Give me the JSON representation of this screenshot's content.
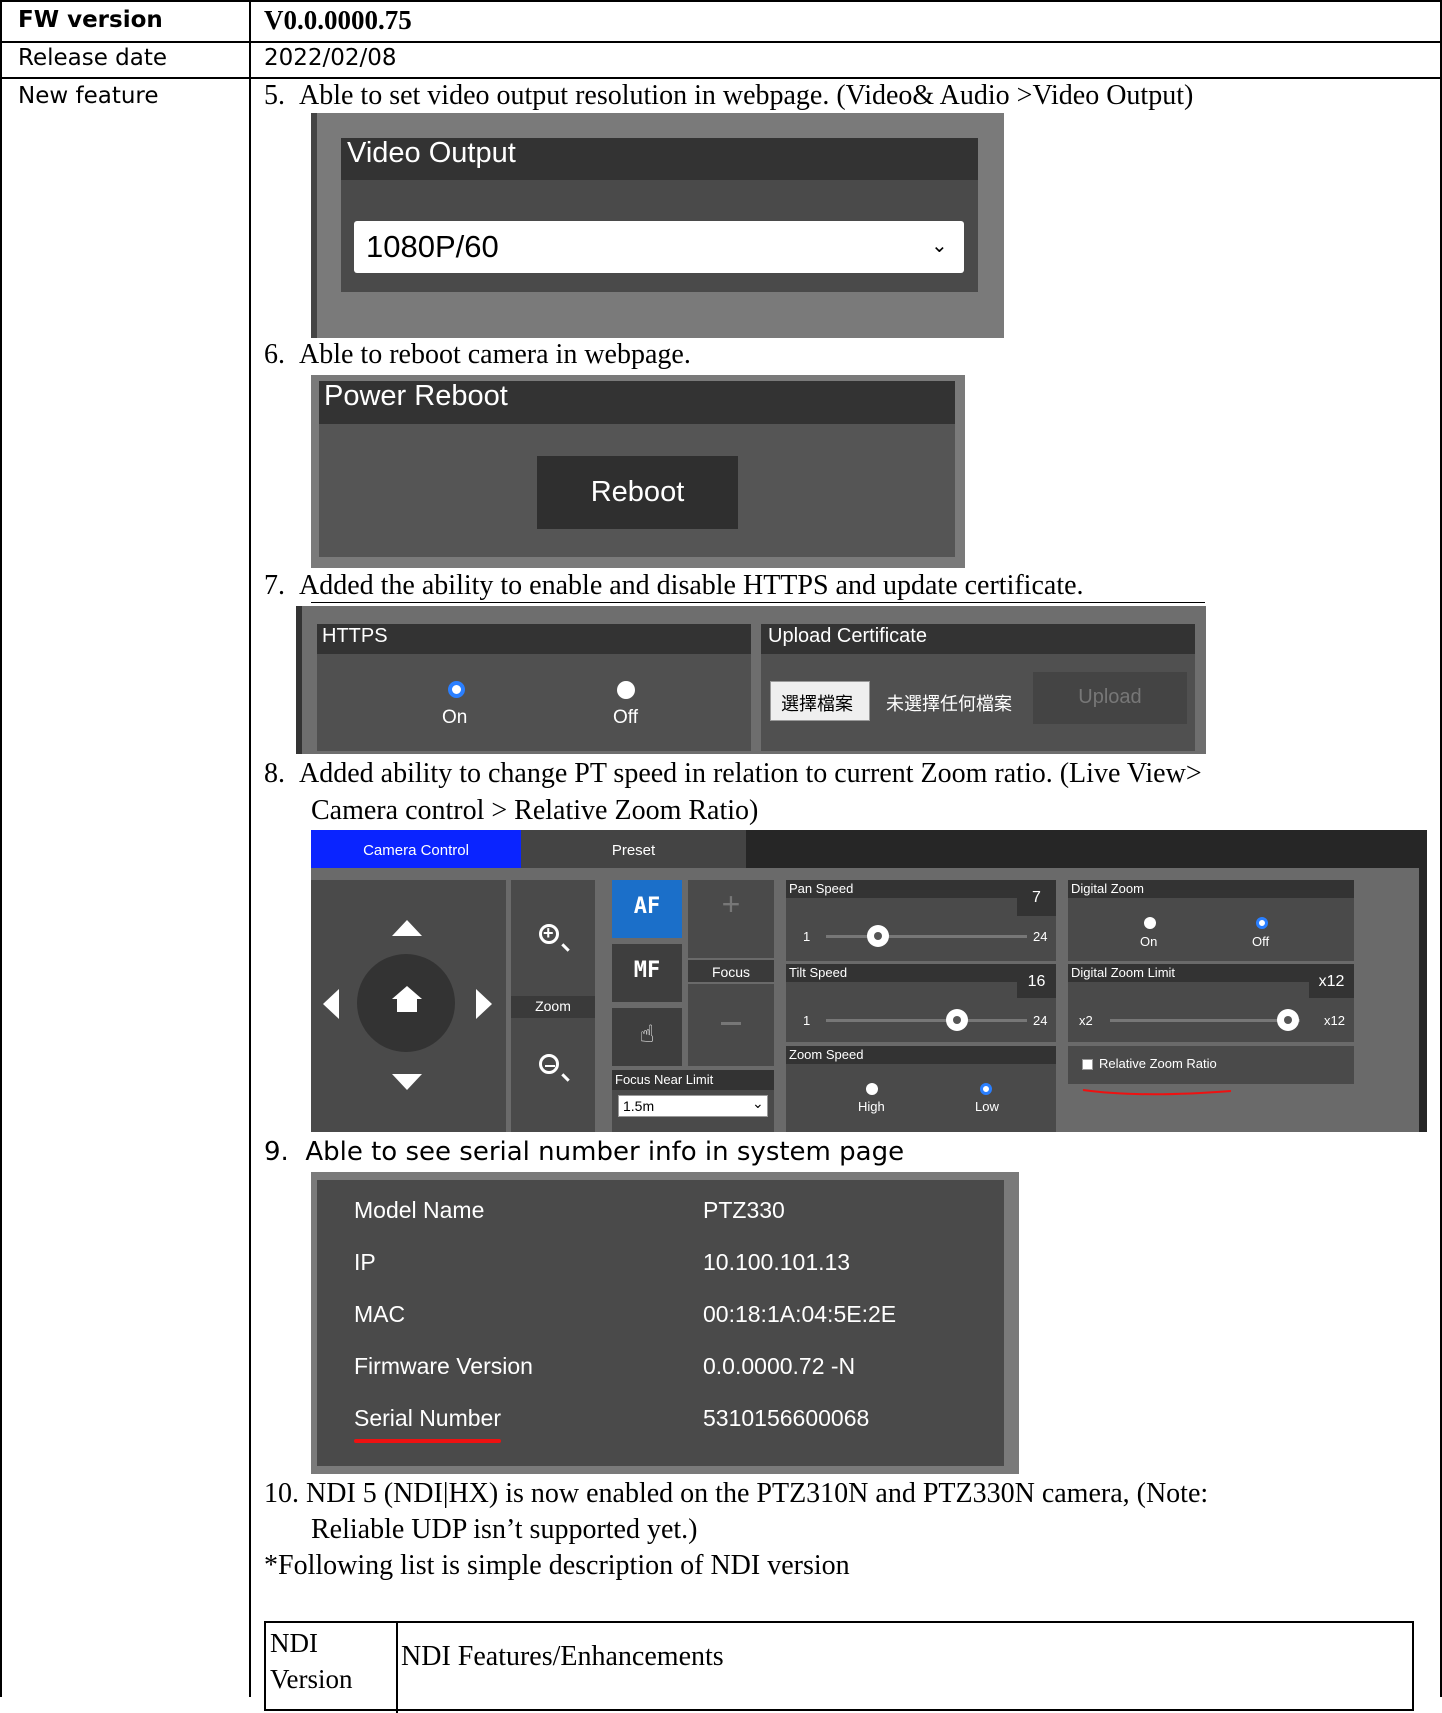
{
  "table": {
    "fw_label": "FW version",
    "fw_value": "V0.0.0000.75",
    "release_label": "Release date",
    "release_value": "2022/02/08",
    "feature_label": "New feature"
  },
  "items": {
    "i5": "5.  Able to set video output resolution in webpage. (Video& Audio >Video Output)",
    "i6": "6.  Able to reboot camera in webpage.",
    "i7": "7.  Added the ability to enable and disable HTTPS and update certificate.",
    "i8a": "8.  Added ability to change PT speed in relation to current Zoom ratio. (Live View>",
    "i8b": "Camera control > Relative Zoom Ratio)",
    "i9": "9.  Able to see serial number info in system page",
    "i10a": "10. NDI 5 (NDI|HX) is now enabled on the PTZ310N and PTZ330N camera, (Note:",
    "i10b": "Reliable UDP isn’t supported yet.)",
    "note": "*Following list is simple description of NDI version"
  },
  "video_output": {
    "title": "Video Output",
    "value": "1080P/60"
  },
  "power_reboot": {
    "title": "Power Reboot",
    "button": "Reboot"
  },
  "https": {
    "title": "HTTPS",
    "on": "On",
    "off": "Off",
    "upload_title": "Upload Certificate",
    "choose_file": "選擇檔案",
    "no_file": "未選擇任何檔案",
    "upload": "Upload"
  },
  "camera_control": {
    "tab_camera": "Camera Control",
    "tab_preset": "Preset",
    "zoom": "Zoom",
    "af": "AF",
    "mf": "MF",
    "focus": "Focus",
    "focus_near_limit": "Focus Near Limit",
    "focus_near_value": "1.5m",
    "pan_speed": "Pan Speed",
    "pan_value": "7",
    "pan_min": "1",
    "pan_max": "24",
    "pan_fraction": 0.26,
    "tilt_speed": "Tilt Speed",
    "tilt_value": "16",
    "tilt_min": "1",
    "tilt_max": "24",
    "tilt_fraction": 0.65,
    "zoom_speed": "Zoom Speed",
    "high": "High",
    "low": "Low",
    "digital_zoom": "Digital Zoom",
    "dz_on": "On",
    "dz_off": "Off",
    "dz_limit": "Digital Zoom Limit",
    "dz_limit_value": "x12",
    "dz_min": "x2",
    "dz_max": "x12",
    "relative_zoom": "Relative Zoom Ratio"
  },
  "system_info": {
    "rows": [
      {
        "label": "Model Name",
        "value": "PTZ330"
      },
      {
        "label": "IP",
        "value": "10.100.101.13"
      },
      {
        "label": "MAC",
        "value": "00:18:1A:04:5E:2E"
      },
      {
        "label": "Firmware Version",
        "value": "0.0.0000.72 -N"
      },
      {
        "label": "Serial Number",
        "value": "5310156600068"
      }
    ]
  },
  "ndi_table": {
    "col1_line1": "NDI",
    "col1_line2": "Version",
    "col2": "NDI Features/Enhancements"
  },
  "colors": {
    "panel": "#595959",
    "header": "#333333",
    "tab_active": "#0a24ff",
    "af_blue": "#1b6fc9",
    "underline_red": "#e11"
  }
}
